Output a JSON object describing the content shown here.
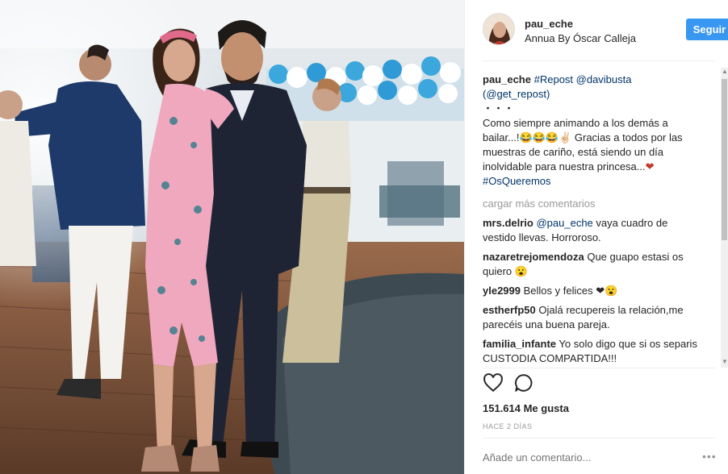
{
  "post": {
    "username": "pau_eche",
    "location": "Annua By Óscar Calleja",
    "follow_label": "Seguir",
    "caption": {
      "username": "pau_eche",
      "tags_line": "#Repost @davibusta",
      "repost_line": "(@get_repost)",
      "dots": "・・・",
      "text": "Como siempre animando a los demás a bailar...!😂😂😂✌🏻 Gracias a todos por las muestras de cariño, está siendo un día inolvidable para nuestra princesa...",
      "heart": "❤",
      "hashtag": "#OsQueremos"
    },
    "load_more": "cargar más comentarios",
    "comments": [
      {
        "username": "mrs.delrio",
        "mention": "@pau_eche",
        "text": " vaya cuadro de vestido llevas. Horroroso."
      },
      {
        "username": "nazaretrejomendoza",
        "mention": "",
        "text": "Que guapo estasi os quiero 😮"
      },
      {
        "username": "yle2999",
        "mention": "",
        "text": "Bellos y felices ❤😮"
      },
      {
        "username": "estherfp50",
        "mention": "",
        "text": "Ojalá recupereis la relación,me parecéis una buena pareja."
      },
      {
        "username": "familia_infante",
        "mention": "",
        "text": "Yo solo digo que si os separis CUSTODIA COMPARTIDA!!!"
      }
    ],
    "likes": "151.614 Me gusta",
    "time": "HACE 2 DÍAS",
    "add_comment_placeholder": "Añade un comentario...",
    "more_options": "•••"
  },
  "colors": {
    "accent": "#3897f0",
    "link": "#003569",
    "muted": "#999999"
  },
  "icons": {
    "like": "heart-outline-icon",
    "comment": "speech-bubble-icon",
    "scroll_up": "triangle-up-icon",
    "scroll_down": "triangle-down-icon"
  }
}
